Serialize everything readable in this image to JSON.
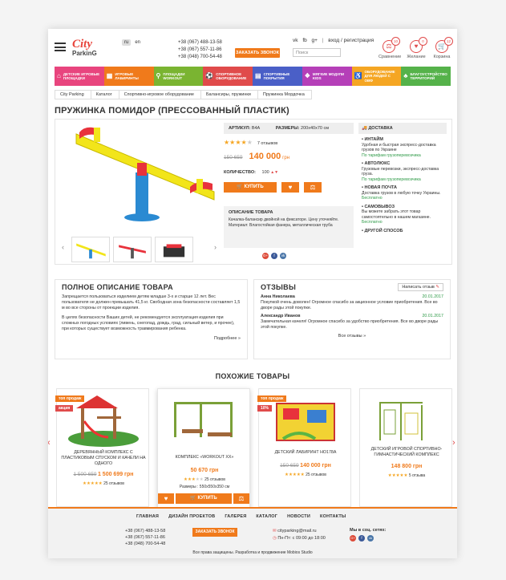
{
  "header": {
    "logo_top": "City",
    "logo_bottom": "ParkinG",
    "langs": [
      "ru",
      "en"
    ],
    "phones": [
      "+38 (067) 488-13-58",
      "+38 (067) 557-11-86",
      "+38 (048) 700-54-48"
    ],
    "call_button": "ЗАКАЗАТЬ ЗВОНОК",
    "social": [
      "vk",
      "fb",
      "g+"
    ],
    "auth": "вход / регистрация",
    "search_placeholder": "Поиск",
    "icons": [
      {
        "label": "Сравнение",
        "count": "10",
        "icon": "compare-icon"
      },
      {
        "label": "Желание",
        "count": "0",
        "icon": "heart-icon"
      },
      {
        "label": "Корзина",
        "count": "12",
        "icon": "cart-icon"
      }
    ]
  },
  "menu": [
    {
      "label": "ДЕТСКИЕ ИГРОВЫЕ ПЛОЩАДКИ",
      "color": "#e8457e"
    },
    {
      "label": "ИГРОВЫЕ ЛАБИРИНТЫ",
      "color": "#f07a1b"
    },
    {
      "label": "ПЛОЩАДКИ WORKOUT",
      "color": "#7ab431"
    },
    {
      "label": "СПОРТИВНОЕ ОБОРУДОВАНИЕ",
      "color": "#e04b4b"
    },
    {
      "label": "СПОРТИВНЫЕ ПОКРЫТИЯ",
      "color": "#4a5fc7"
    },
    {
      "label": "МЯГКИЕ МОДУЛИ KIDS",
      "color": "#b53fb8"
    },
    {
      "label": "ОБОРУДОВАНИЕ ДЛЯ ЛЮДЕЙ С ОВФ",
      "color": "#f5a623"
    },
    {
      "label": "БЛАГОУСТРОЙСТВО ТЕРРИТОРИЙ",
      "color": "#55b24a"
    }
  ],
  "breadcrumb": [
    "City Parking",
    "Каталог",
    "Спортивно-игровое оборудование",
    "Балансиры, пружинки",
    "Пружинка Мордочка"
  ],
  "product": {
    "title": "ПРУЖИНКА ПОМИДОР (ПРЕССОВАННЫЙ ПЛАСТИК)",
    "sku_label": "АРТИКУЛ:",
    "sku": "В4А",
    "size_label": "РАЗМЕРЫ:",
    "size": "200х40х70 см",
    "rating": 4,
    "reviews": "7 отзывов",
    "old_price": "150 659",
    "new_price": "140 000",
    "currency": "грн",
    "qty_label": "КОЛИЧЕСТВО:",
    "qty": "100",
    "buy_label": "КУПИТЬ",
    "desc_title": "ОПИСАНИЕ ТОВАРА",
    "desc": "Качалка-балансир двойной на фиксаторе. Цену уточняйте. Материал: Влагостойкая фанера, металлическая труба",
    "share": [
      {
        "icon": "google-plus-icon",
        "color": "#dd4b39",
        "glyph": "G+"
      },
      {
        "icon": "facebook-icon",
        "color": "#3b5998",
        "glyph": "f"
      },
      {
        "icon": "vk-icon",
        "color": "#4a76a8",
        "glyph": "vk"
      }
    ]
  },
  "delivery": {
    "title": "ДОСТАВКА",
    "items": [
      {
        "name": "ИНТАЙМ",
        "text": "Удобная и быстрая экспресс-доставка грузов по Украине",
        "link": "По тарифам грузоперевозчика"
      },
      {
        "name": "АВТОЛЮКС",
        "text": "Грузовые перевозки, экспресс-доставка груза.",
        "link": "По тарифам грузоперевозчика"
      },
      {
        "name": "НОВАЯ ПОЧТА",
        "text": "Доставка грузов в любую точку Украины.",
        "link": "Бесплатно"
      },
      {
        "name": "САМОВЫВОЗ",
        "text": "Вы можете забрать этот товар самостоятельно в нашем магазине.",
        "link": "Бесплатно"
      },
      {
        "name": "ДРУГОЙ СПОСОБ",
        "text": "",
        "link": ""
      }
    ]
  },
  "full_desc": {
    "title": "ПОЛНОЕ ОПИСАНИЕ ТОВАРА",
    "p1": "Запрещается пользоваться изделием детям младше 3-х и старше 12 лет. Вес пользователя не должен превышать 41,5 кг. Свободная зона безопасности составляет 1,5 м во все стороны от проекции изделия.",
    "p2": "В целях безопасности Ваших детей, не рекомендуется эксплуатация изделия при сложных погодных условиях (ливень, снегопад, дождь, град, сильный ветер, и прочее), при которых существует возможность травмирования ребенка.",
    "more": "Подробнее »"
  },
  "reviews": {
    "title": "ОТЗЫВЫ",
    "write": "Написать отзыв",
    "items": [
      {
        "name": "Анна Николаева",
        "date": "20.01.2017",
        "text": "Покупкой очень доволен! Огромное спасибо за акционное условие приобретения. Все во дворе рады этой покупке."
      },
      {
        "name": "Александр Иванов",
        "date": "20.01.2017",
        "text": "Замечательная качеля! Огромное спасибо за удобство приобретения. Все во дворе рады этой покупке."
      }
    ],
    "all": "Все отзывы »"
  },
  "similar": {
    "title": "ПОХОЖИЕ ТОВАРЫ",
    "items": [
      {
        "tag": "топ продаж",
        "tag2": "акция",
        "name": "ДЕРЕВЯННЫЙ КОМПЛЕКС С ПЛАСТИКОВЫМ СПУСКОМ И КАЧЕЛИ НА ОДНОГО",
        "old": "1 500 659",
        "price": "1 500 699 грн",
        "reviews": "25 отзывов"
      },
      {
        "tag": "",
        "tag2": "",
        "name": "КОМПЛЕКС «WORKOUT XX»",
        "old": "",
        "price": "50 670 грн",
        "reviews": "25 отзывов",
        "size": "Размеры : 550х550х350 см",
        "buy": "КУПИТЬ"
      },
      {
        "tag": "топ продаж",
        "tag2": "10%",
        "name": "ДЕТСКИЙ ЛАБИРИНТ НО178А",
        "old": "150 659",
        "price": "140 000 грн",
        "reviews": "25 отзывов"
      },
      {
        "tag": "",
        "tag2": "",
        "name": "ДЕТСКИЙ ИГРОВОЙ СПОРТИВНО-ГИМНАСТИЧЕСКИЙ КОМПЛЕКС",
        "old": "",
        "price": "148 800 грн",
        "reviews": "5 отзыва"
      }
    ]
  },
  "footer": {
    "nav": [
      "ГЛАВНАЯ",
      "ДИЗАЙН ПРОЕКТОВ",
      "ГАЛЕРЕЯ",
      "КАТАЛОГ",
      "НОВОСТИ",
      "КОНТАКТЫ"
    ],
    "phones": [
      "+38 (067) 488-13-58",
      "+38 (067) 557-11-86",
      "+38 (048) 700-54-48"
    ],
    "call": "ЗАКАЗАТЬ ЗВОНОК",
    "email": "cityparking@mail.ru",
    "hours": "Пн-Пт: с 09:00 до 18:00",
    "social_title": "Мы в соц. сетях:",
    "copyright": "Все права защищены. Разработка и продвижение Mobios Studio"
  },
  "colors": {
    "accent": "#f07a1b",
    "green": "#2e9a47",
    "red": "#e04b4b"
  }
}
